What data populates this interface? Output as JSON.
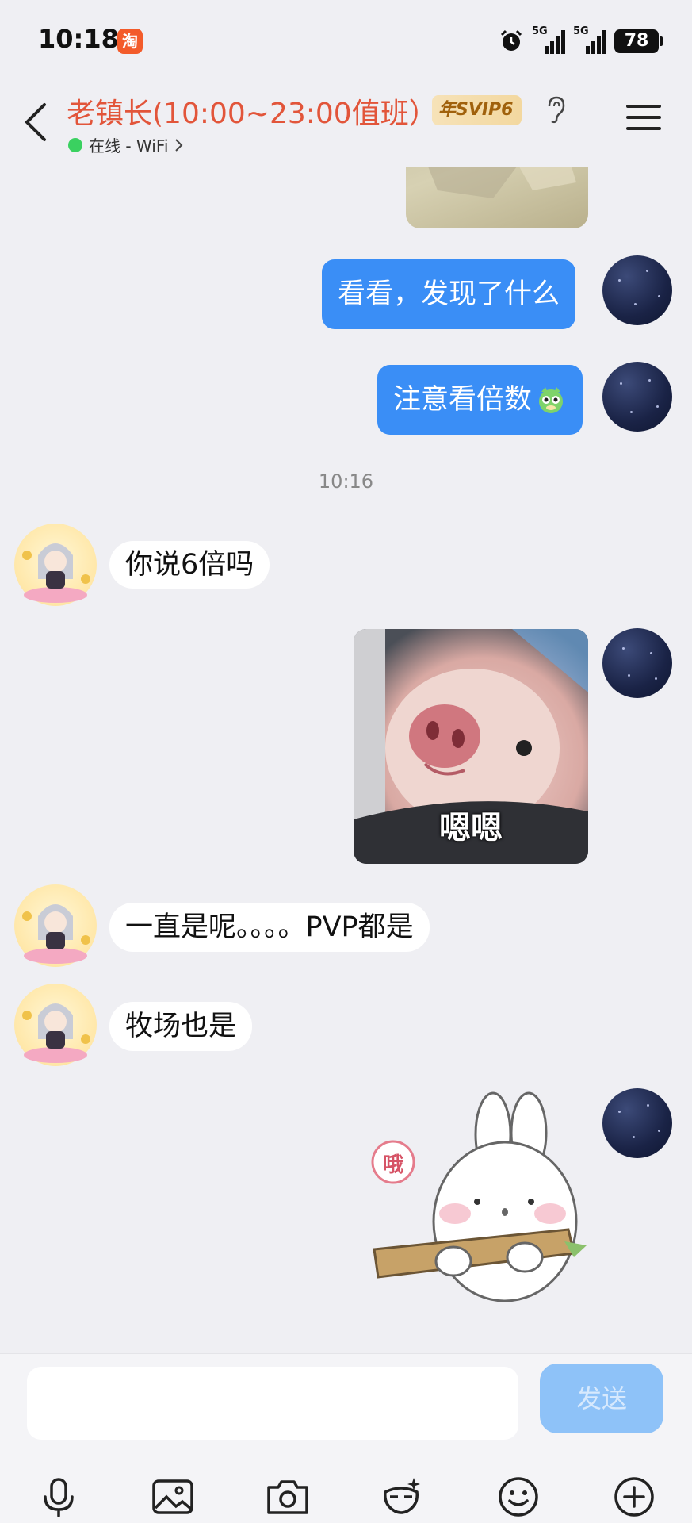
{
  "status_bar": {
    "time": "10:18",
    "app_icon_text": "淘",
    "signal1_label": "5G",
    "signal2_label": "5G",
    "battery": "78"
  },
  "header": {
    "title": "老镇长(10:00~23:00值班）",
    "svip_badge": "年SVIP6",
    "status_text": "在线 - WiFi",
    "back_icon": "chevron-left-icon",
    "ear_icon": "ear-icon",
    "menu_icon": "menu-icon"
  },
  "messages": [
    {
      "side": "right",
      "type": "text",
      "text": "看看，发现了什么"
    },
    {
      "side": "right",
      "type": "text",
      "text": "注意看倍数"
    },
    {
      "type": "time",
      "text": "10:16"
    },
    {
      "side": "left",
      "type": "text",
      "text": "你说6倍吗"
    },
    {
      "side": "right",
      "type": "sticker",
      "caption": "嗯嗯"
    },
    {
      "side": "left",
      "type": "text",
      "text": "一直是呢。。。。PVP都是"
    },
    {
      "side": "left",
      "type": "text",
      "text": "牧场也是"
    },
    {
      "side": "right",
      "type": "sticker",
      "caption": "哦"
    }
  ],
  "input": {
    "placeholder": "",
    "send_label": "发送"
  },
  "toolbar": [
    "mic-icon",
    "image-icon",
    "camera-icon",
    "photo-editor-icon",
    "emoji-icon",
    "plus-icon"
  ],
  "colors": {
    "accent": "#3a8ef6",
    "title": "#e2553a",
    "background": "#efeff3"
  }
}
